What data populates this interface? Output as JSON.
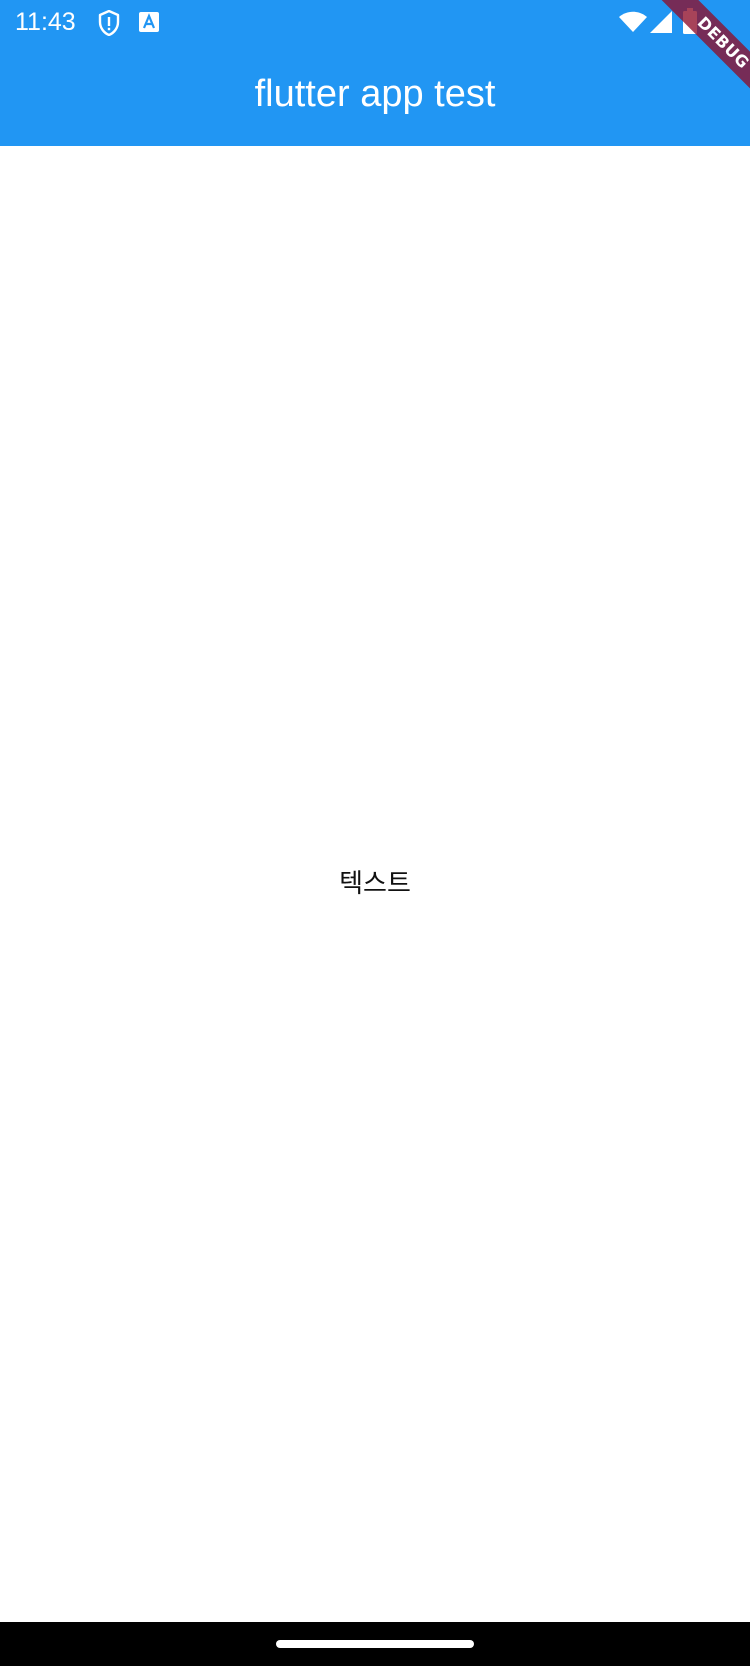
{
  "status_bar": {
    "time": "11:43",
    "left_icons": [
      "shield-alert-icon",
      "text-a-icon"
    ],
    "right_icons": [
      "wifi-icon",
      "cellular-signal-icon",
      "battery-icon"
    ]
  },
  "app_bar": {
    "title": "flutter app test",
    "color": "#2196f3"
  },
  "debug_banner": {
    "label": "DEBUG",
    "color": "#8e0e2a"
  },
  "body": {
    "text": "텍스트"
  },
  "nav_bar": {
    "handle": "home-handle"
  }
}
